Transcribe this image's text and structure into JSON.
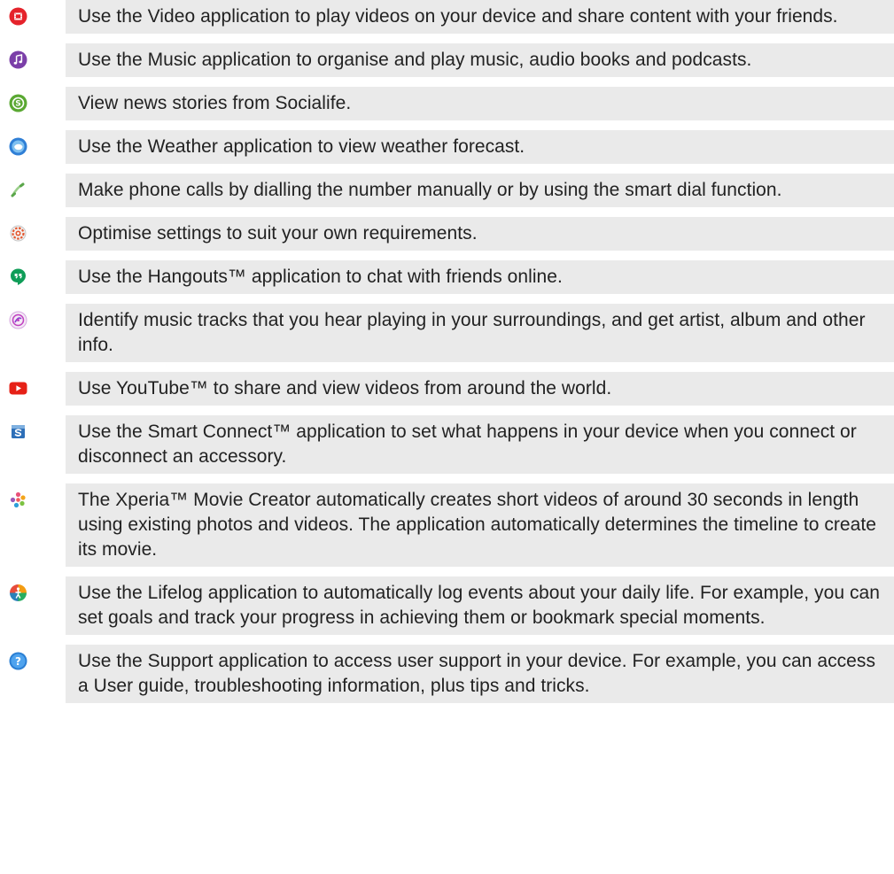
{
  "apps": [
    {
      "icon": "video-icon",
      "text": "Use the Video application to play videos on your device and share content with your friends."
    },
    {
      "icon": "music-icon",
      "text": "Use the Music application to organise and play music, audio books and podcasts."
    },
    {
      "icon": "socialife-icon",
      "text": "View news stories from Socialife."
    },
    {
      "icon": "weather-icon",
      "text": "Use the Weather application to view weather forecast."
    },
    {
      "icon": "phone-icon",
      "text": "Make phone calls by dialling the number manually or by using the smart dial function."
    },
    {
      "icon": "settings-icon",
      "text": "Optimise settings to suit your own requirements."
    },
    {
      "icon": "hangouts-icon",
      "text": "Use the Hangouts™ application to chat with friends online."
    },
    {
      "icon": "trackid-icon",
      "text": "Identify music tracks that you hear playing in your surroundings, and get artist, album and other info."
    },
    {
      "icon": "youtube-icon",
      "text": "Use YouTube™ to share and view videos from around the world."
    },
    {
      "icon": "smart-connect-icon",
      "text": "Use the Smart Connect™ application to set what happens in your device when you connect or disconnect an accessory."
    },
    {
      "icon": "movie-creator-icon",
      "text": "The Xperia™ Movie Creator automatically creates short videos of around 30 seconds in length using existing photos and videos. The application automatically determines the timeline to create its movie."
    },
    {
      "icon": "lifelog-icon",
      "text": "Use the Lifelog application to automatically log events about your daily life. For example, you can set goals and track your progress in achieving them or bookmark special moments."
    },
    {
      "icon": "support-icon",
      "text": "Use the Support application to access user support in your device. For example, you can access a User guide, troubleshooting information, plus tips and tricks."
    }
  ]
}
